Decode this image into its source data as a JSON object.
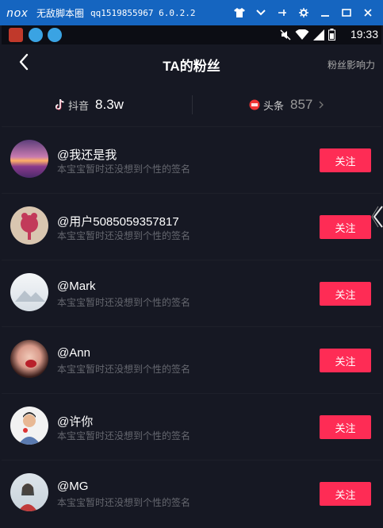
{
  "emulator": {
    "logo": "nox",
    "title": "无敌脚本圈",
    "version": "qq1519855967 6.0.2.2"
  },
  "status_bar": {
    "time": "19:33"
  },
  "header": {
    "title": "TA的粉丝",
    "action": "粉丝影响力"
  },
  "platforms": [
    {
      "label": "抖音",
      "count": "8.3w"
    },
    {
      "label": "头条",
      "count": "857"
    }
  ],
  "follow_label": "关注",
  "fans": [
    {
      "name": "@我还是我",
      "signature": "本宝宝暂时还没想到个性的签名"
    },
    {
      "name": "@用户5085059357817",
      "signature": "本宝宝暂时还没想到个性的签名"
    },
    {
      "name": "@Mark",
      "signature": "本宝宝暂时还没想到个性的签名"
    },
    {
      "name": "@Ann",
      "signature": "本宝宝暂时还没想到个性的签名"
    },
    {
      "name": "@许你",
      "signature": "本宝宝暂时还没想到个性的签名"
    },
    {
      "name": "@MG",
      "signature": "本宝宝暂时还没想到个性的签名"
    }
  ],
  "colors": {
    "background": "#161823",
    "follow_button": "#fe2c55",
    "emulator_bar": "#1565c0"
  }
}
